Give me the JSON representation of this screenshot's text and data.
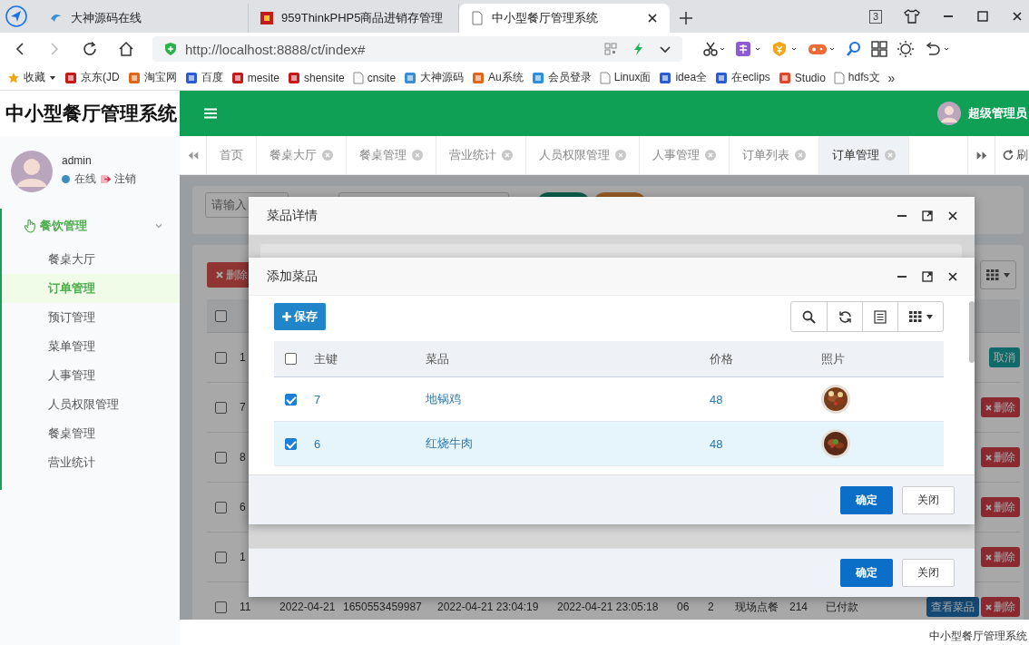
{
  "browser": {
    "tabs": [
      {
        "title": "大神源码在线",
        "selected": false
      },
      {
        "title": "959ThinkPHP5商品进销存管理",
        "selected": false
      },
      {
        "title": "中小型餐厅管理系统",
        "selected": true
      }
    ],
    "window_count": "3",
    "url": "http://localhost:8888/ct/index#",
    "bookmarks": [
      "收藏",
      "京东(JD",
      "淘宝网",
      "百度",
      "mesite",
      "shensite",
      "cnsite",
      "大神源码",
      "Au系统",
      "会员登录",
      "Linux面",
      "idea全",
      "在eclips",
      "Studio",
      "hdfs文"
    ],
    "bookmarks_more": "»"
  },
  "app": {
    "title": "中小型餐厅管理系统",
    "user_name": "超级管理员"
  },
  "sidebar": {
    "user": {
      "name": "admin",
      "status": "在线",
      "logout": "注销"
    },
    "menu": [
      {
        "label": "餐饮管理",
        "expanded": true,
        "children": [
          {
            "label": "餐桌大厅",
            "selected": false
          },
          {
            "label": "订单管理",
            "selected": true
          },
          {
            "label": "预订管理",
            "selected": false
          },
          {
            "label": "菜单管理",
            "selected": false
          },
          {
            "label": "人事管理",
            "selected": false
          },
          {
            "label": "人员权限管理",
            "selected": false
          },
          {
            "label": "餐桌管理",
            "selected": false
          },
          {
            "label": "营业统计",
            "selected": false
          }
        ]
      }
    ]
  },
  "page_tabs": [
    {
      "label": "首页",
      "closable": false,
      "selected": false
    },
    {
      "label": "餐桌大厅",
      "closable": true,
      "selected": false
    },
    {
      "label": "餐桌管理",
      "closable": true,
      "selected": false
    },
    {
      "label": "营业统计",
      "closable": true,
      "selected": false
    },
    {
      "label": "人员权限管理",
      "closable": true,
      "selected": false
    },
    {
      "label": "人事管理",
      "closable": true,
      "selected": false
    },
    {
      "label": "订单列表",
      "closable": true,
      "selected": false
    },
    {
      "label": "订单管理",
      "closable": true,
      "selected": true
    }
  ],
  "refresh_label": "刷",
  "search": {
    "placeholder": "请输入"
  },
  "table": {
    "delete_label": "删除",
    "select_all": false,
    "rows": [
      {
        "checked": false,
        "cells": [
          "1"
        ],
        "actions": [
          {
            "label": "取消",
            "kind": "cancel"
          }
        ]
      },
      {
        "checked": false,
        "cells": [
          "7"
        ],
        "actions": [
          {
            "label": "删除",
            "kind": "delete"
          }
        ]
      },
      {
        "checked": false,
        "cells": [
          "8"
        ],
        "actions": [
          {
            "label": "删除",
            "kind": "delete"
          }
        ]
      },
      {
        "checked": false,
        "cells": [
          "6"
        ],
        "actions": [
          {
            "label": "删除",
            "kind": "delete"
          }
        ]
      },
      {
        "checked": false,
        "cells": [
          "1"
        ],
        "actions": [
          {
            "label": "删除",
            "kind": "delete"
          }
        ]
      },
      {
        "checked": false,
        "cells": [
          "11",
          "2022-04-21",
          "1650553459987",
          "2022-04-21 23:04:19",
          "2022-04-21 23:05:18",
          "06",
          "2",
          "现场点餐",
          "214",
          "已付款"
        ],
        "actions": [
          {
            "label": "查看菜品",
            "kind": "view"
          },
          {
            "label": "删除",
            "kind": "delete"
          }
        ]
      }
    ]
  },
  "dialogs": [
    {
      "title": "菜品详情",
      "buttons": [
        {
          "label": "确定",
          "kind": "primary"
        },
        {
          "label": "关闭",
          "kind": "default"
        }
      ]
    },
    {
      "title": "添加菜品",
      "save_label": "保存",
      "columns": [
        "主键",
        "菜品",
        "价格",
        "照片"
      ],
      "select_all": false,
      "rows": [
        {
          "checked": true,
          "hovered": false,
          "id": "7",
          "dish": "地锅鸡",
          "price": "48"
        },
        {
          "checked": true,
          "hovered": true,
          "id": "6",
          "dish": "红烧牛肉",
          "price": "48"
        }
      ],
      "buttons": [
        {
          "label": "确定",
          "kind": "primary"
        },
        {
          "label": "关闭",
          "kind": "default"
        }
      ]
    }
  ],
  "footer": "中小型餐厅管理系统"
}
